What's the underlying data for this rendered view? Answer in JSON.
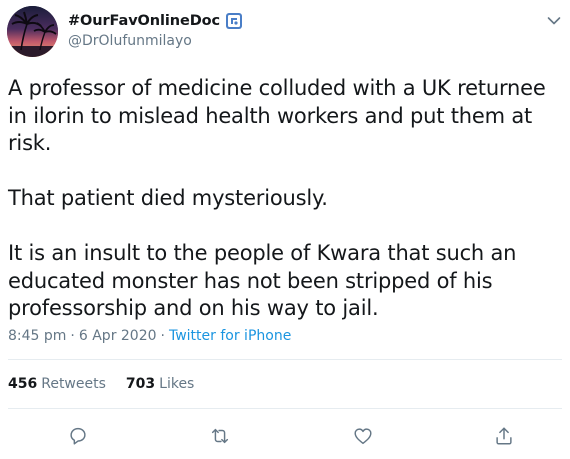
{
  "user": {
    "display_name": "#OurFavOnlineDoc",
    "handle": "@DrOlufunmilayo"
  },
  "tweet": {
    "paragraphs": [
      "A professor of medicine colluded with a UK returnee in ilorin to mislead health workers and put them at risk.",
      "That patient died mysteriously.",
      "It is an insult to the people of Kwara that such an educated monster has not been stripped of his professorship and on his way to jail."
    ],
    "time": "8:45 pm",
    "date": "6 Apr 2020",
    "separator": "·",
    "source": "Twitter for iPhone"
  },
  "stats": {
    "retweets_count": "456",
    "retweets_label": "Retweets",
    "likes_count": "703",
    "likes_label": "Likes"
  },
  "icons": {
    "verified_badge": "medical-badge-icon",
    "menu": "chevron-down-icon",
    "reply": "reply-icon",
    "retweet": "retweet-icon",
    "like": "heart-icon",
    "share": "share-icon"
  },
  "colors": {
    "text": "#14171a",
    "secondary": "#657786",
    "link": "#1b95e0",
    "badge": "#4a7ec7",
    "divider": "#e6ecf0"
  }
}
